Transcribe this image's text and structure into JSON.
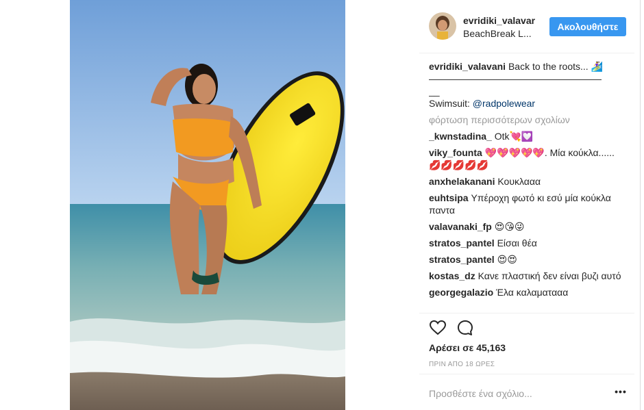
{
  "post": {
    "username": "evridiki_valavar",
    "location": "BeachBreak L...",
    "follow_label": "Ακολουθήστε",
    "caption_user": "evridiki_valavani",
    "caption_text": "Back to the roots... 🏄‍♀️",
    "caption_rule": "——————————————————",
    "caption_rule2": "__",
    "caption_swimsuit_prefix": "Swimsuit:",
    "caption_mention": "@radpolewear",
    "load_more": "φόρτωση περισσότερων σχολίων",
    "likes": "Αρέσει σε 45,163",
    "time": "ΠΡΙΝ ΑΠΟ 18 ΩΡΕΣ",
    "add_comment_placeholder": "Προσθέστε ένα σχόλιο...",
    "more_options": "•••"
  },
  "comments": [
    {
      "user": "_kwnstadina_",
      "text": "Otk💘💟"
    },
    {
      "user": "viky_founta",
      "text": "💖💖💖💖💖. Μία κούκλα...... 💋💋💋💋💋"
    },
    {
      "user": "anxhelakanani",
      "text": "Κουκλααα"
    },
    {
      "user": "euhtsipa",
      "text": "Υπέροχη φωτό κι εσύ μία κούκλα παντα"
    },
    {
      "user": "valavanaki_fp",
      "text": "😍😘😜"
    },
    {
      "user": "stratos_pantel",
      "text": "Είσαι θέα"
    },
    {
      "user": "stratos_pantel",
      "text": "😍😍"
    },
    {
      "user": "kostas_dz",
      "text": "Κανε πλαστική δεν είναι βυζι αυτό"
    },
    {
      "user": "georgegalazio",
      "text": "Έλα καλαματααα"
    }
  ],
  "icons": {
    "like": "heart-icon",
    "comment": "comment-bubble-icon",
    "more": "more-options-icon"
  },
  "colors": {
    "accent": "#3897f0",
    "muted": "#999999",
    "mention": "#003569",
    "border": "#efefef"
  }
}
